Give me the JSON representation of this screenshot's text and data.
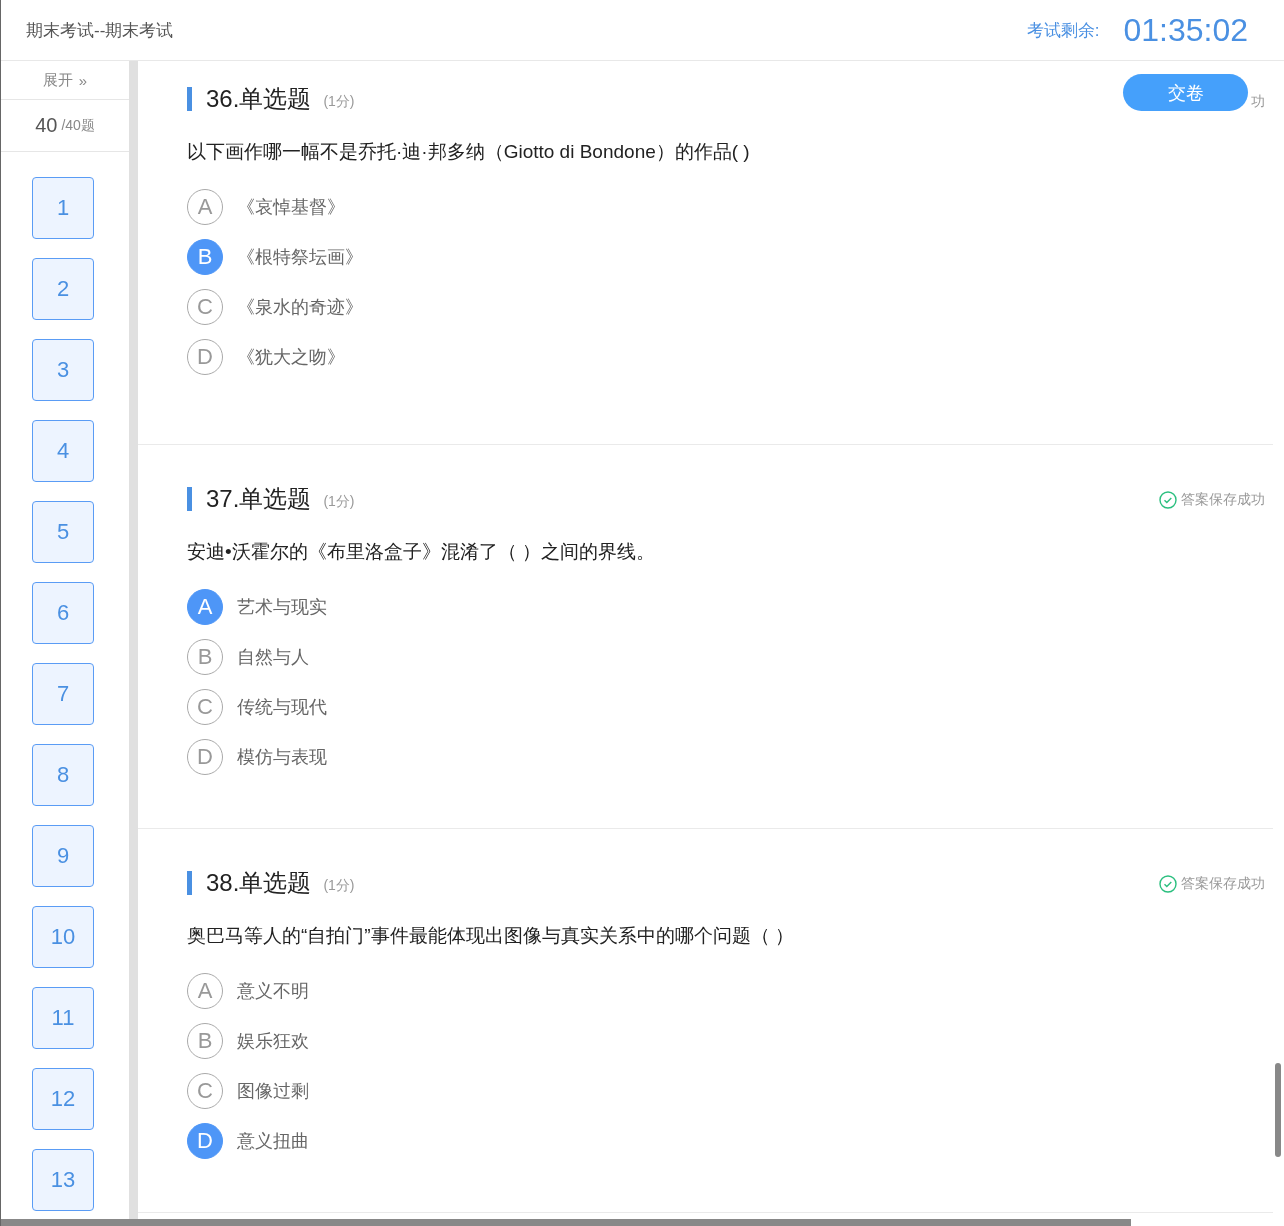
{
  "header": {
    "title": "期末考试--期末考试",
    "timer_label": "考试剩余:",
    "timer": "01:35:02"
  },
  "sidebar": {
    "expand": "展开",
    "expand_icon": "»",
    "answered": "40",
    "total": "/40题",
    "numbers": [
      "1",
      "2",
      "3",
      "4",
      "5",
      "6",
      "7",
      "8",
      "9",
      "10",
      "11",
      "12",
      "13"
    ]
  },
  "submit_button": "交卷",
  "questions": [
    {
      "title": "36.单选题",
      "score": "(1分)",
      "saved": {
        "kind": "text",
        "text": "功"
      },
      "text": "以下画作哪一幅不是乔托·迪·邦多纳（Giotto di Bondone）的作品(    )",
      "options": [
        {
          "letter": "A",
          "text": "《哀悼基督》",
          "selected": false
        },
        {
          "letter": "B",
          "text": "《根特祭坛画》",
          "selected": true
        },
        {
          "letter": "C",
          "text": "《泉水的奇迹》",
          "selected": false
        },
        {
          "letter": "D",
          "text": "《犹大之吻》",
          "selected": false
        }
      ]
    },
    {
      "title": "37.单选题",
      "score": "(1分)",
      "saved": {
        "kind": "check",
        "text": "答案保存成功"
      },
      "text": "安迪•沃霍尔的《布里洛盒子》混淆了（ ）之间的界线。",
      "options": [
        {
          "letter": "A",
          "text": "艺术与现实",
          "selected": true
        },
        {
          "letter": "B",
          "text": "自然与人",
          "selected": false
        },
        {
          "letter": "C",
          "text": "传统与现代",
          "selected": false
        },
        {
          "letter": "D",
          "text": "模仿与表现",
          "selected": false
        }
      ]
    },
    {
      "title": "38.单选题",
      "score": "(1分)",
      "saved": {
        "kind": "check",
        "text": "答案保存成功"
      },
      "text": "奥巴马等人的“自拍门”事件最能体现出图像与真实关系中的哪个问题（ ）",
      "options": [
        {
          "letter": "A",
          "text": "意义不明",
          "selected": false
        },
        {
          "letter": "B",
          "text": "娱乐狂欢",
          "selected": false
        },
        {
          "letter": "C",
          "text": "图像过剩",
          "selected": false
        },
        {
          "letter": "D",
          "text": "意义扭曲",
          "selected": true
        }
      ]
    }
  ]
}
